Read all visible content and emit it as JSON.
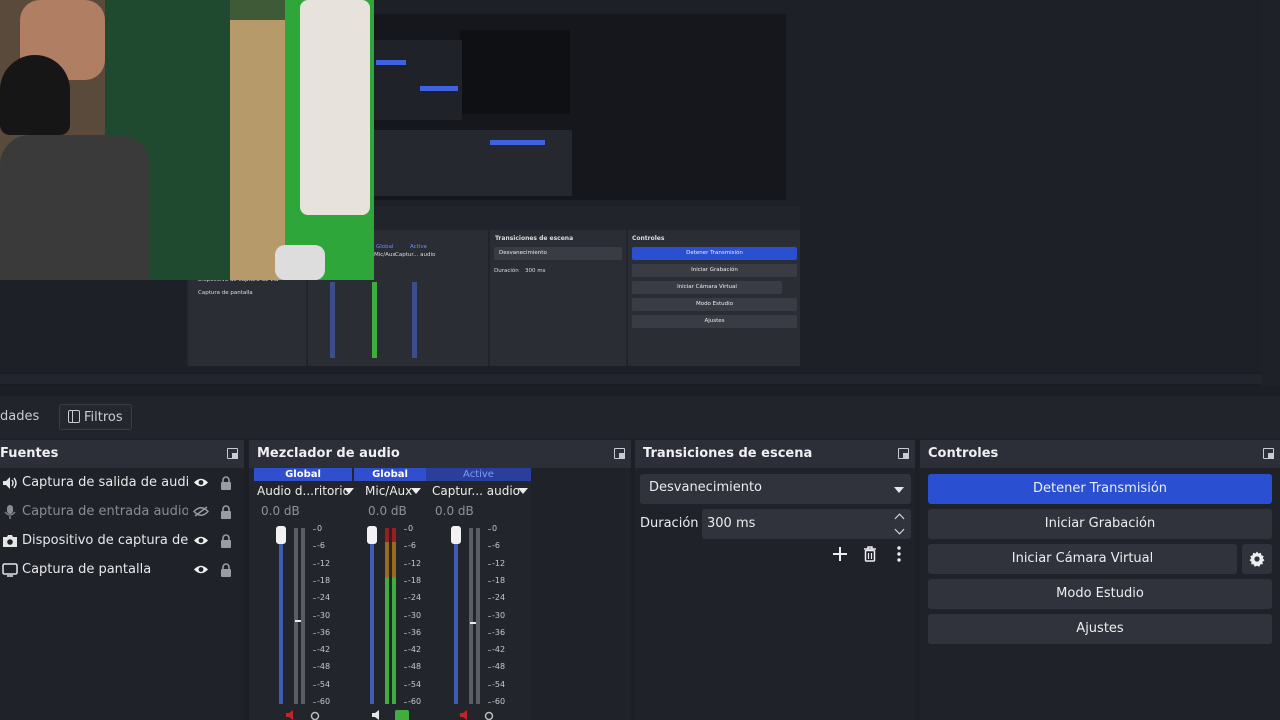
{
  "tabs": {
    "properties_partial": "dades",
    "filters": "Filtros"
  },
  "sources": {
    "title": "Fuentes",
    "items": [
      {
        "label": "Captura de salida de audio",
        "icon": "speaker-icon",
        "visible": true,
        "dim": false
      },
      {
        "label": "Captura de entrada audio",
        "icon": "microphone-icon",
        "visible": false,
        "dim": true
      },
      {
        "label": "Dispositivo de captura de vídeo",
        "icon": "camera-icon",
        "visible": true,
        "dim": false
      },
      {
        "label": "Captura de pantalla",
        "icon": "monitor-icon",
        "visible": true,
        "dim": false
      }
    ]
  },
  "mixer": {
    "title": "Mezclador de audio",
    "channels": [
      {
        "header": "Global",
        "name": "Audio d...ritorio",
        "db": "0.0 dB",
        "level": 0
      },
      {
        "header": "Global",
        "name": "Mic/Aux",
        "db": "0.0 dB",
        "level": 0.72
      },
      {
        "header": "Active",
        "name": "Captur... audio",
        "db": "0.0 dB",
        "level": 0
      }
    ],
    "scale": [
      "0",
      "-6",
      "-12",
      "-18",
      "-24",
      "-30",
      "-36",
      "-42",
      "-48",
      "-54",
      "-60"
    ]
  },
  "transitions": {
    "title": "Transiciones de escena",
    "selected": "Desvanecimiento",
    "duration_label": "Duración",
    "duration_value": "300 ms"
  },
  "controls": {
    "title": "Controles",
    "buttons": {
      "stop_stream": "Detener Transmisión",
      "start_record": "Iniciar Grabación",
      "virtual_cam": "Iniciar Cámara Virtual",
      "studio_mode": "Modo Estudio",
      "settings": "Ajustes"
    }
  },
  "nested": {
    "sources_items": [
      "Dispositivo de captura de vid",
      "Captura de pantalla"
    ],
    "mixer_heads": [
      "Global",
      "Active"
    ],
    "mixer_names": [
      "Mic/Aux",
      "Captur... audio"
    ],
    "transitions_title": "Transiciones de escena",
    "transitions_selected": "Desvanecimiento",
    "duration_label": "Duración",
    "duration_value": "300 ms",
    "controls_title": "Controles",
    "buttons": [
      "Detener Transmisión",
      "Iniciar Grabación",
      "Iniciar Cámara Virtual",
      "Modo Estudio",
      "Ajustes"
    ]
  },
  "colors": {
    "accent": "#2a4fd0",
    "meter_green": "#3fae3f",
    "meter_red": "#9a1f1f"
  }
}
